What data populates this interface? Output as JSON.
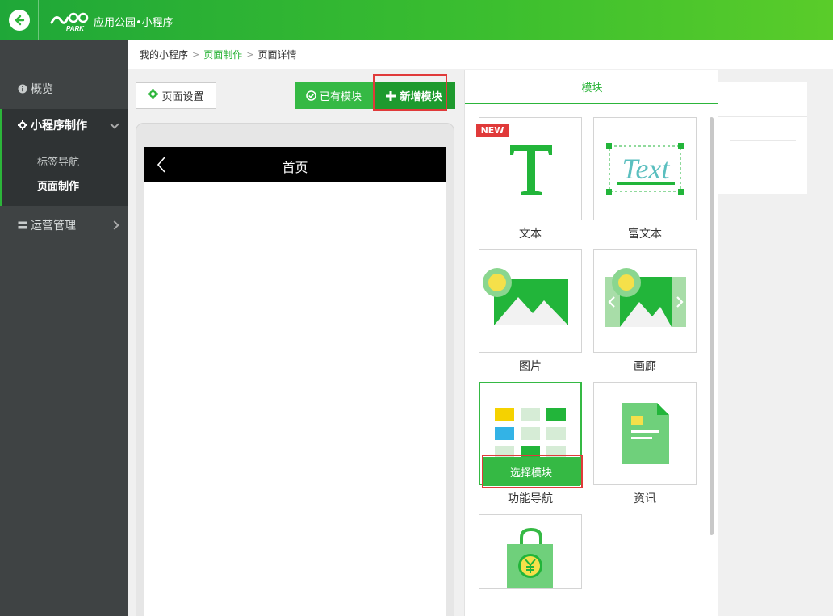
{
  "header": {
    "app_name": "应用公园•小程序",
    "logo_text": "PARK",
    "brand_color": "#2cb53a"
  },
  "sidebar": {
    "overview": "概览",
    "make": "小程序制作",
    "sub_items": [
      "标签导航",
      "页面制作"
    ],
    "ops": "运营管理"
  },
  "breadcrumb": [
    "我的小程序",
    "页面制作",
    "页面详情"
  ],
  "toolbar": {
    "settings": "页面设置",
    "existing": "已有模块",
    "new": "新增模块"
  },
  "phone": {
    "title": "首页"
  },
  "panel": {
    "tab": "模块",
    "badge": "NEW",
    "select_label": "选择模块",
    "modules": [
      "文本",
      "富文本",
      "图片",
      "画廊",
      "功能导航",
      "资讯"
    ],
    "rich_text_sample": "Text"
  }
}
